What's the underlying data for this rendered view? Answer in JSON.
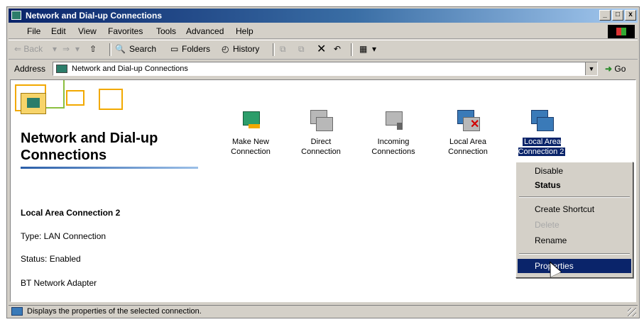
{
  "window": {
    "title": "Network and Dial-up Connections",
    "controls": {
      "minimize": "_",
      "maximize": "□",
      "close": "x"
    }
  },
  "menubar": {
    "items": [
      "File",
      "Edit",
      "View",
      "Favorites",
      "Tools",
      "Advanced",
      "Help"
    ]
  },
  "toolbar": {
    "back": "⇐ Back",
    "forward": "⇒",
    "up": "⇧",
    "search": "Search",
    "folders": "Folders",
    "history": "History"
  },
  "address": {
    "label": "Address",
    "value": "Network and Dial-up Connections",
    "go": "Go"
  },
  "panel": {
    "title": "Network and Dial-up Connections",
    "selected_name": "Local Area Connection 2",
    "type": "Type: LAN Connection",
    "status": "Status: Enabled",
    "adapter": "BT Network Adapter"
  },
  "icons": [
    {
      "label": "Make New Connection",
      "icon": "make-new-connection-icon"
    },
    {
      "label": "Direct Connection",
      "icon": "direct-connection-icon"
    },
    {
      "label": "Incoming Connections",
      "icon": "incoming-connections-icon"
    },
    {
      "label": "Local Area Connection",
      "icon": "disconnected-lan-icon"
    },
    {
      "label": "Local Area Connection 2",
      "icon": "lan-icon",
      "selected": true
    }
  ],
  "context_menu": {
    "items": [
      {
        "label": "Disable",
        "style": "normal"
      },
      {
        "label": "Status",
        "style": "bold"
      },
      {
        "label": "Create Shortcut",
        "style": "normal"
      },
      {
        "label": "Delete",
        "style": "disabled"
      },
      {
        "label": "Rename",
        "style": "normal"
      },
      {
        "label": "Properties",
        "style": "highlight"
      }
    ]
  },
  "statusbar": {
    "text": "Displays the properties of the selected connection."
  },
  "colors": {
    "titlebar_start": "#0a246a",
    "highlight": "#0a246a",
    "face": "#d4d0c8"
  }
}
